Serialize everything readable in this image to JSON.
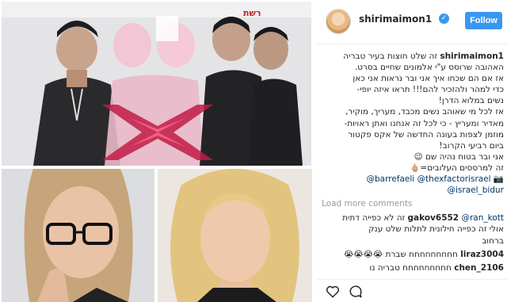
{
  "top_image": {
    "logo_text": "רשת"
  },
  "post": {
    "username": "shirimaimon1",
    "follow_label": "Follow"
  },
  "caption": {
    "user": "shirimaimon1",
    "lines": [
      "זה שלט חוצות בעיר טבריה",
      "האהובה שרוסס ע\"י אלמונים שחיים בסרט.",
      "אז אם הם שכחו איך אני ובר נראות אני כאן",
      "כדי למהר ולהזכיר להם!!! תראו איזה יופי-",
      "נשים במלוא הדרן!",
      "אז לכל מי שאוהב נשים מכבד, מעריך, מוקיר,",
      "מאדיר ומעריץ - כי לכל זה אנחנו ואתן ראויות-",
      "מוזמן לצפות בעונה החדשה של אקס פקטור",
      "ביום רביעי הקרוב!",
      "אני ובר בטוח נהיה שם 😉",
      "זה למרססים העלובים=🖕🏼"
    ],
    "mention_line1": "@barrefaeli @thexfactorisrael 📷",
    "mention_line2": "@israel_bidur"
  },
  "load_more": "Load more comments",
  "comments": [
    {
      "user": "gakov6552",
      "mention": "@ran_kott",
      "text": "זה לא כפייה דתית",
      "extra_lines": [
        "אולי זה כפייה חילונית לתלות שלט ענק",
        "ברחוב"
      ]
    },
    {
      "user": "liraz3004",
      "text": "חחחחחחחחח שברת 😭😭😭😭",
      "extra_lines": []
    },
    {
      "user": "chen_2106",
      "text": "חחחחחחחחח טבריה נו",
      "extra_lines": []
    }
  ],
  "colors": {
    "accent": "#3897f0",
    "mention": "#003569",
    "muted": "#999999"
  }
}
